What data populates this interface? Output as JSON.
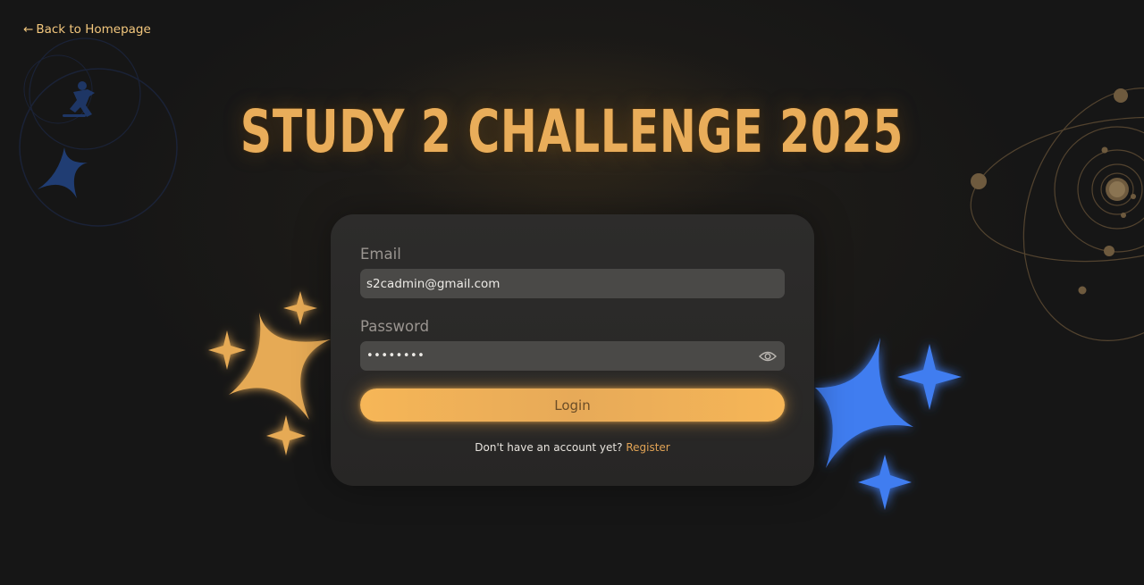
{
  "nav": {
    "back_arrow": "←",
    "back_label": "Back to Homepage"
  },
  "header": {
    "title": "STUDY 2 CHALLENGE 2025"
  },
  "login_form": {
    "email_label": "Email",
    "email_value": "s2cadmin@gmail.com",
    "password_label": "Password",
    "password_value": "••••••••",
    "show_password_icon": "eye-icon",
    "login_label": "Login",
    "register_prompt": "Don't have an account yet?",
    "register_link": "Register"
  },
  "colors": {
    "accent": "#f6b657",
    "title": "#e9ad5a",
    "link": "#f3c77d",
    "blue_star": "#3f7df0",
    "background": "#161616",
    "card": "#2a2928",
    "input": "#4a4947"
  }
}
